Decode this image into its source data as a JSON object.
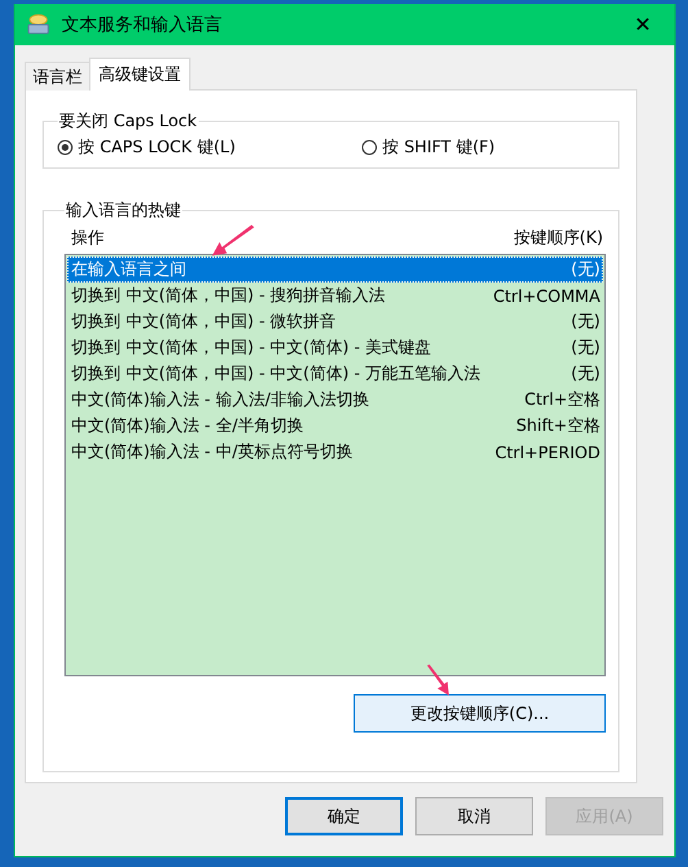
{
  "window": {
    "title": "文本服务和输入语言",
    "close": "✕"
  },
  "tabs": [
    {
      "label": "语言栏",
      "selected": false
    },
    {
      "label": "高级键设置",
      "selected": true
    }
  ],
  "caps_lock_group": {
    "title": "要关闭 Caps Lock",
    "options": [
      {
        "label": "按 CAPS LOCK 键(L)",
        "selected": true
      },
      {
        "label": "按 SHIFT 键(F)",
        "selected": false
      }
    ]
  },
  "hotkeys_group": {
    "title": "输入语言的热键",
    "columns": [
      "操作",
      "按键顺序(K)"
    ],
    "rows": [
      {
        "action": "在输入语言之间",
        "keys": "(无)",
        "selected": true
      },
      {
        "action": "切换到 中文(简体，中国) - 搜狗拼音输入法",
        "keys": "Ctrl+COMMA",
        "selected": false
      },
      {
        "action": "切换到 中文(简体，中国) - 微软拼音",
        "keys": "(无)",
        "selected": false
      },
      {
        "action": "切换到 中文(简体，中国) - 中文(简体) - 美式键盘",
        "keys": "(无)",
        "selected": false
      },
      {
        "action": "切换到 中文(简体，中国) - 中文(简体) - 万能五笔输入法",
        "keys": "(无)",
        "selected": false
      },
      {
        "action": "中文(简体)输入法 - 输入法/非输入法切换",
        "keys": "Ctrl+空格",
        "selected": false
      },
      {
        "action": "中文(简体)输入法 - 全/半角切换",
        "keys": "Shift+空格",
        "selected": false
      },
      {
        "action": "中文(简体)输入法 - 中/英标点符号切换",
        "keys": "Ctrl+PERIOD",
        "selected": false
      }
    ],
    "change_button": "更改按键顺序(C)..."
  },
  "buttons": [
    {
      "label": "确定",
      "default": true,
      "disabled": false
    },
    {
      "label": "取消",
      "default": false,
      "disabled": false
    },
    {
      "label": "应用(A)",
      "default": false,
      "disabled": true
    }
  ]
}
